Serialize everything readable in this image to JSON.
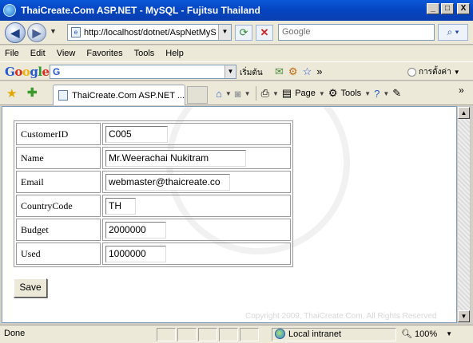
{
  "window": {
    "title": "ThaiCreate.Com ASP.NET - MySQL - Fujitsu Thailand",
    "min": "_",
    "max": "□",
    "close": "X"
  },
  "nav": {
    "url": "http://localhost/dotnet/AspNetMyS",
    "search_placeholder": "Google"
  },
  "menu": [
    "File",
    "Edit",
    "View",
    "Favorites",
    "Tools",
    "Help"
  ],
  "google_bar": {
    "logo": [
      "G",
      "o",
      "o",
      "g",
      "l",
      "e"
    ],
    "box_letter": "G",
    "start_label": "เริ่มต้น",
    "settings_label": "การตั้งค่า",
    "more": "»"
  },
  "tabbar": {
    "tab_title": "ThaiCreate.Com ASP.NET ...",
    "page_label": "Page",
    "tools_label": "Tools",
    "more": "»"
  },
  "form": {
    "rows": [
      {
        "label": "CustomerID",
        "value": "C005"
      },
      {
        "label": "Name",
        "value": "Mr.Weerachai Nukitram"
      },
      {
        "label": "Email",
        "value": "webmaster@thaicreate.co"
      },
      {
        "label": "CountryCode",
        "value": "TH"
      },
      {
        "label": "Budget",
        "value": "2000000"
      },
      {
        "label": "Used",
        "value": "1000000"
      }
    ],
    "save_label": "Save"
  },
  "watermark": {
    "copyright": "Copyright 2009, ThaiCreate.Com, All Rights Reserved"
  },
  "status": {
    "text": "Done",
    "zone": "Local intranet",
    "zoom": "100%"
  }
}
